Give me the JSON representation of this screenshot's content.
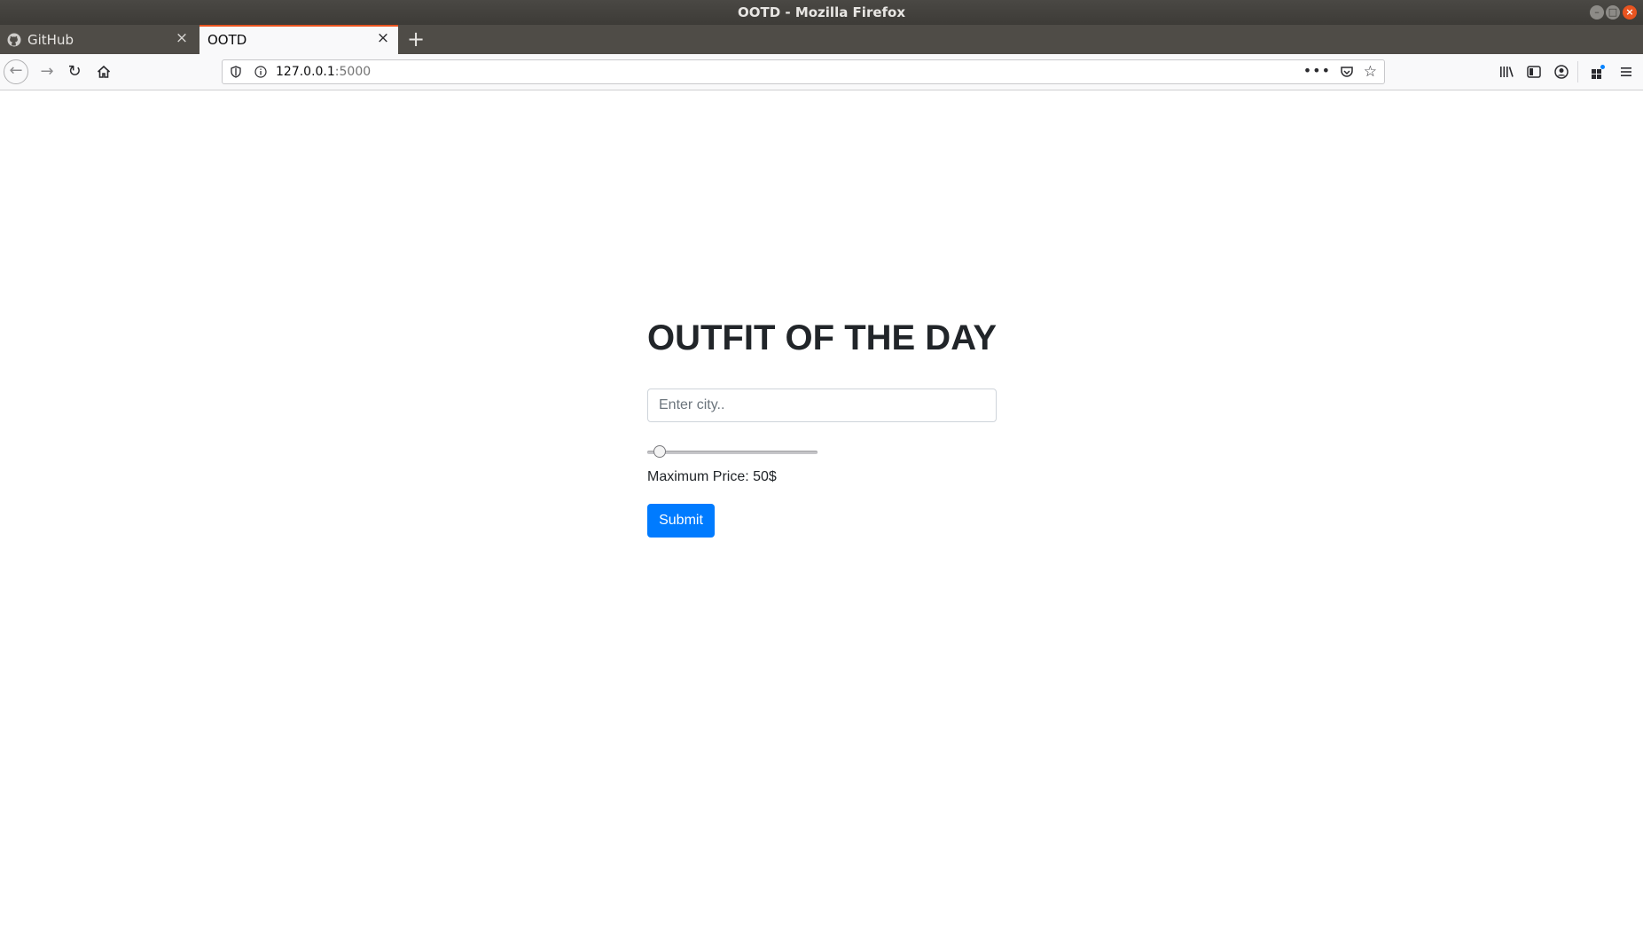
{
  "window": {
    "title": "OOTD - Mozilla Firefox"
  },
  "tabs": [
    {
      "label": "GitHub",
      "active": false,
      "icon": "github-icon"
    },
    {
      "label": "OOTD",
      "active": true
    }
  ],
  "navbar": {
    "url_host": "127.0.0.1",
    "url_port": ":5000"
  },
  "page": {
    "heading": "OUTFIT OF THE DAY",
    "city_placeholder": "Enter city..",
    "city_value": "",
    "max_price_label": "Maximum Price: 50$",
    "max_price_slider_fraction": 0.04,
    "submit_label": "Submit"
  },
  "colors": {
    "accent_tab": "#e95420",
    "submit_bg": "#007bff",
    "heading_text": "#212529"
  }
}
